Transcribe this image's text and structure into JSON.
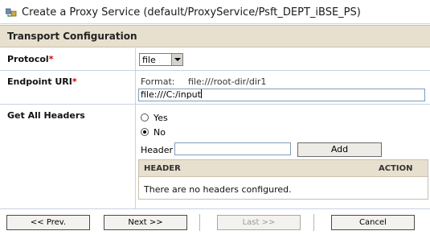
{
  "window": {
    "title": "Create a Proxy Service (default/ProxyService/Psft_DEPT_iBSE_PS)",
    "icon": "proxy-service-icon"
  },
  "section": {
    "title": "Transport Configuration"
  },
  "protocol": {
    "label": "Protocol",
    "required_mark": "*",
    "value": "file"
  },
  "endpoint": {
    "label": "Endpoint URI",
    "required_mark": "*",
    "format_label": "Format:",
    "format_value": "file:///root-dir/dir1",
    "value": "file:///C:/input"
  },
  "headers": {
    "label": "Get All Headers",
    "yes_label": "Yes",
    "no_label": "No",
    "selected": "No",
    "header_field_label": "Header",
    "header_value": "",
    "add_label": "Add",
    "table_columns": [
      "HEADER",
      "ACTION"
    ],
    "empty_text": "There are no headers configured."
  },
  "footer": {
    "prev_label": "<< Prev.",
    "next_label": "Next >>",
    "last_label": "Last >>",
    "cancel_label": "Cancel"
  },
  "colors": {
    "section_bg": "#e8e0cf",
    "required": "#d20000",
    "border": "#c8d2de"
  }
}
